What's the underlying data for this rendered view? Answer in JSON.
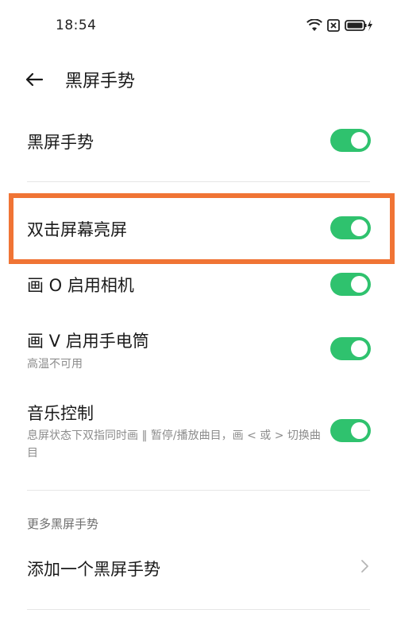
{
  "status_bar": {
    "time": "18:54",
    "icons": [
      "wifi-icon",
      "sim-blocked-icon",
      "battery-charging-icon"
    ]
  },
  "header": {
    "title": "黑屏手势"
  },
  "settings": [
    {
      "label": "黑屏手势",
      "sublabel": "",
      "enabled": true
    },
    {
      "label": "双击屏幕亮屏",
      "sublabel": "",
      "enabled": true,
      "highlighted": true
    },
    {
      "label": "画 O 启用相机",
      "sublabel": "",
      "enabled": true
    },
    {
      "label": "画 V 启用手电筒",
      "sublabel": "高温不可用",
      "enabled": true
    },
    {
      "label": "音乐控制",
      "sublabel": "息屏状态下双指同时画 ‖ 暂停/播放曲目，画 < 或 > 切换曲目",
      "enabled": true
    }
  ],
  "more_section": {
    "header": "更多黑屏手势",
    "add_item_label": "添加一个黑屏手势"
  },
  "colors": {
    "toggle_on": "#2fc26e",
    "highlight": "#f07435"
  }
}
